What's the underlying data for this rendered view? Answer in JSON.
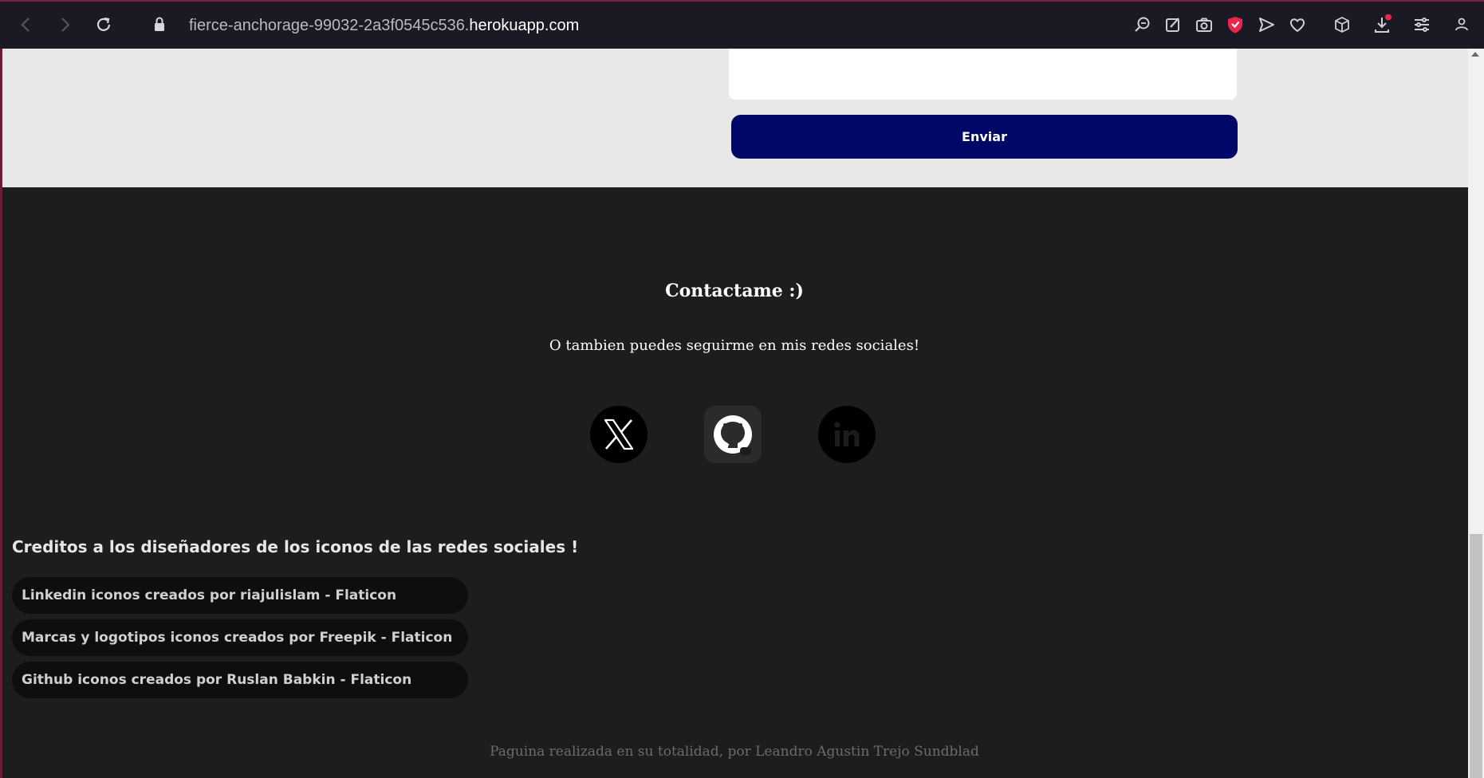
{
  "browser": {
    "url_path": "fierce-anchorage-99032-2a3f0545c536.",
    "url_host": "herokuapp.com",
    "icons": [
      "back-icon",
      "forward-icon",
      "reload-icon",
      "lock-icon",
      "zoom-search-icon",
      "edit-icon",
      "camera-icon",
      "shield-icon",
      "send-icon",
      "heart-icon",
      "cube-icon",
      "download-icon",
      "settings-sliders-icon",
      "profile-icon"
    ]
  },
  "form": {
    "send_label": "Enviar"
  },
  "footer": {
    "contact_title": "Contactame :)",
    "contact_subtitle": "O tambien puedes seguirme en mis redes sociales!",
    "social": [
      {
        "name": "x-twitter",
        "icon": "x-logo-icon"
      },
      {
        "name": "github",
        "icon": "github-logo-icon"
      },
      {
        "name": "linkedin",
        "icon": "linkedin-logo-icon"
      }
    ],
    "credits_title": "Creditos a los diseñadores de los iconos de las redes sociales !",
    "credits": [
      "Linkedin iconos creados por riajulislam - Flaticon",
      "Marcas y logotipos iconos creados por Freepik - Flaticon",
      "Github iconos creados por Ruslan Babkin - Flaticon"
    ],
    "bottom_note": "Paguina realizada en su totalidad, por Leandro Agustin Trejo Sundblad"
  },
  "colors": {
    "button": "#000766",
    "footer_bg": "#1d1d1e",
    "form_bg": "#e8e8e8",
    "chrome_bg": "#1b1a24"
  }
}
